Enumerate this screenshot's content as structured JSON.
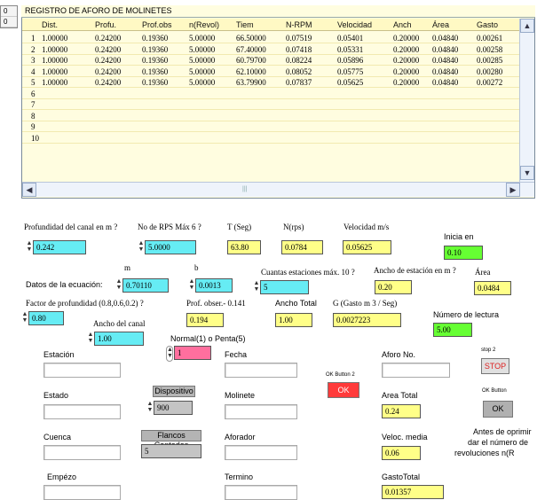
{
  "grid": {
    "title": "REGISTRO DE AFORO DE MOLINETES",
    "side_index": [
      "0",
      "0"
    ],
    "columns": [
      "Dist.",
      "Profu.",
      "Prof.obs",
      "n(Revol)",
      "Tiem",
      "N-RPM",
      "Velocidad",
      "Anch",
      "Área",
      "Gasto"
    ],
    "row_numbers": [
      "1",
      "2",
      "3",
      "4",
      "5",
      "6",
      "7",
      "8",
      "9",
      "10"
    ],
    "rows": [
      [
        "1.00000",
        "0.24200",
        "0.19360",
        "5.00000",
        "66.50000",
        "0.07519",
        "0.05401",
        "0.20000",
        "0.04840",
        "0.00261"
      ],
      [
        "1.00000",
        "0.24200",
        "0.19360",
        "5.00000",
        "67.40000",
        "0.07418",
        "0.05331",
        "0.20000",
        "0.04840",
        "0.00258"
      ],
      [
        "1.00000",
        "0.24200",
        "0.19360",
        "5.00000",
        "60.79700",
        "0.08224",
        "0.05896",
        "0.20000",
        "0.04840",
        "0.00285"
      ],
      [
        "1.00000",
        "0.24200",
        "0.19360",
        "5.00000",
        "62.10000",
        "0.08052",
        "0.05775",
        "0.20000",
        "0.04840",
        "0.00280"
      ],
      [
        "1.00000",
        "0.24200",
        "0.19360",
        "5.00000",
        "63.79900",
        "0.07837",
        "0.05625",
        "0.20000",
        "0.04840",
        "0.00272"
      ]
    ],
    "scroll_up": "▲",
    "scroll_down": "▼",
    "scroll_left": "◀",
    "scroll_right": "▶",
    "hscroll_grip": "|||"
  },
  "controls": {
    "profundidad_label": "Profundidad del canal en m ?",
    "profundidad_value": "0.242",
    "rps_label": "No de RPS Máx 6 ?",
    "rps_value": "5.0000",
    "tseg_label": "T  (Seg)",
    "tseg_value": "63.80",
    "nrps_label": "N(rps)",
    "nrps_value": "0.0784",
    "velocidad_label": "Velocidad m/s",
    "velocidad_value": "0.05625",
    "inicia_label": "Inicia en",
    "inicia_value": "0.10",
    "ecuacion_label": "Datos de la ecuación:",
    "m_label": "m",
    "m_value": "0.70110",
    "b_label": "b",
    "b_value": "0.0013",
    "estaciones_label": "Cuantas estaciones máx. 10 ?",
    "estaciones_value": "5",
    "ancho_est_label": "Ancho de estación en m ?",
    "ancho_est_value": "0.20",
    "area_label": "Área",
    "area_value": "0.0484",
    "factor_label": "Factor de profundidad (0.8,0.6,0.2) ?",
    "factor_value": "0.80",
    "profobs_label": "Prof. obser.- 0.141",
    "profobs_value": "0.194",
    "anchototal_label": "Ancho Total",
    "anchototal_value": "1.00",
    "gasto_label": "G (Gasto m 3 / Seg)",
    "gasto_value": "0.0027223",
    "lectura_label": "Número de lectura",
    "lectura_value": "5.00",
    "anchocanal_label": "Ancho del canal",
    "anchocanal_value": "1.00",
    "normal_label": "Normal(1) o Penta(5)",
    "normal_value": "1"
  },
  "info": {
    "estacion_label": "Estación",
    "fecha_label": "Fecha",
    "aforo_label": "Aforo No.",
    "estado_label": "Estado",
    "dispositivo_label": "Dispositivo",
    "dispositivo_value": "900",
    "molinete_label": "Molinete",
    "area_total_label": "Area Total",
    "area_total_value": "0.24",
    "cuenca_label": "Cuenca",
    "flancos_label": "Flancos Contados",
    "flancos_value": "5",
    "aforador_label": "Aforador",
    "veloc_media_label": "Veloc. media",
    "veloc_media_value": "0.06",
    "empezo_label": "Empézo",
    "termino_label": "Termino",
    "gasto_total_label": "GastoTotal",
    "gasto_total_value": "0.01357"
  },
  "buttons": {
    "stop_caption": "stop 2",
    "stop_label": "STOP",
    "ok2_caption": "OK Button 2",
    "ok2_label": "OK",
    "ok_caption": "OK Button",
    "ok_label": "OK",
    "note_line1": "Antes de oprimir",
    "note_line2": "dar el número de",
    "note_line3": "revoluciones n(R"
  },
  "colors": {
    "cyan": "#66ecf4",
    "yellow": "#ffff88",
    "green": "#66ff33",
    "stop_red": "#ff3b3b",
    "ok_gray": "#b0b0b0"
  }
}
